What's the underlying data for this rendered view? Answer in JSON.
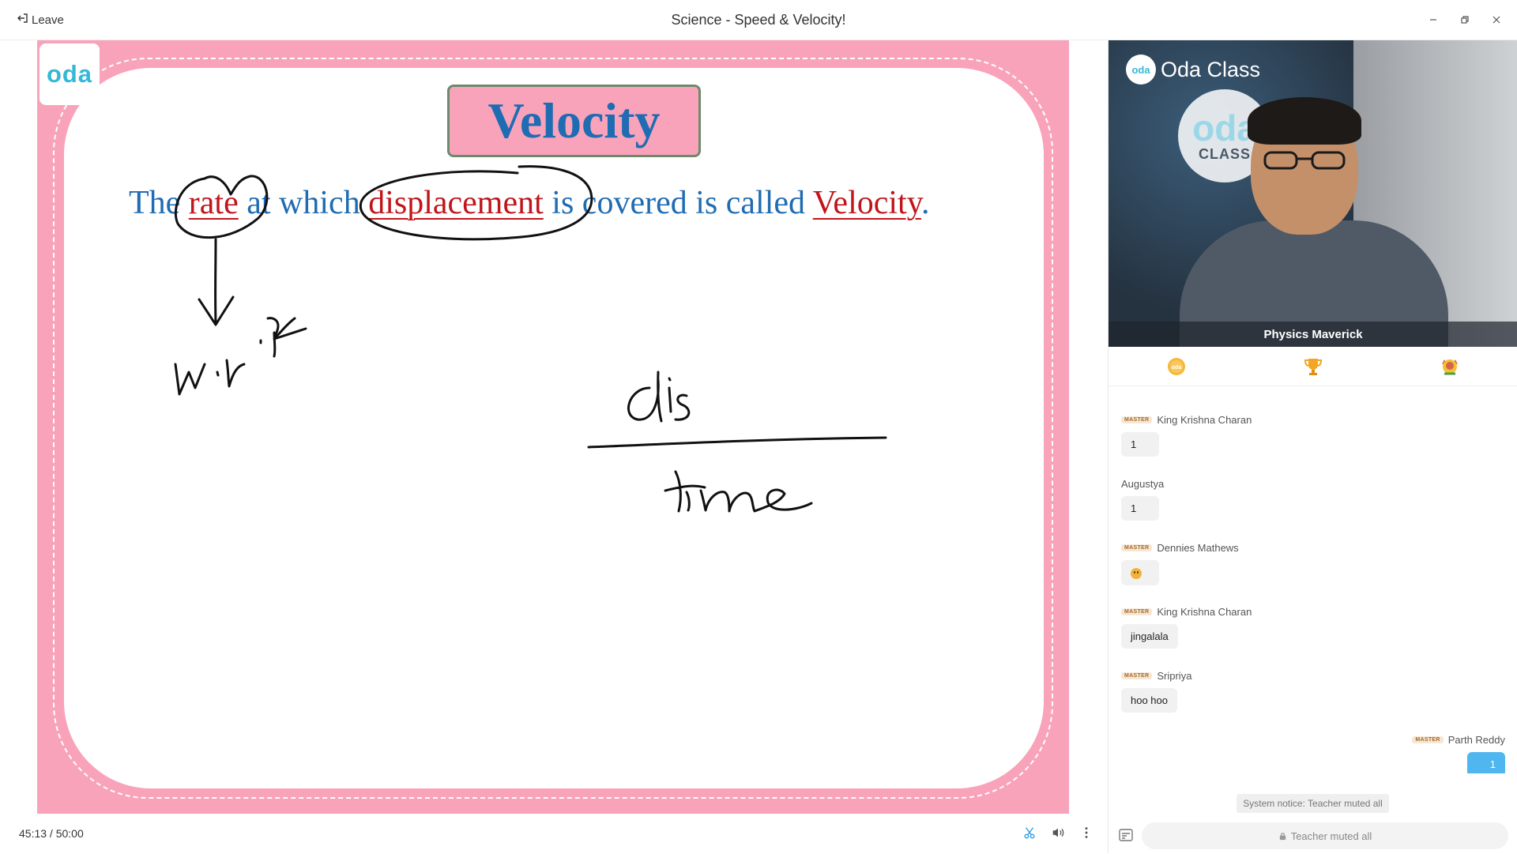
{
  "window": {
    "leave_label": "Leave",
    "title": "Science - Speed & Velocity!",
    "controls": [
      "minimize-icon",
      "restore-icon",
      "close-icon"
    ]
  },
  "slide": {
    "logo_text": "oda",
    "heading": "Velocity",
    "sentence": {
      "w1": "The ",
      "w2": "rate",
      "w3": " at which ",
      "w4": "displacement",
      "w5": " is covered is called ",
      "w6": "Velocity",
      "w7": "."
    },
    "colors": {
      "heading_blue": "#1f6cb3",
      "term_red": "#c0161b",
      "slide_pink": "#f9a3bb"
    }
  },
  "video": {
    "brand": "Oda Class",
    "brand_badge": "oda",
    "wall_logo_top": "oda",
    "wall_logo_bottom": "CLASS",
    "teacher_name": "Physics Maverick"
  },
  "tabs": [
    "chat-coin-icon",
    "trophy-icon",
    "badge-icon"
  ],
  "chat": {
    "master_label": "MASTER",
    "messages": [
      {
        "name": "King Krishna Charan",
        "master": true,
        "text": "1"
      },
      {
        "name": "Augustya",
        "master": false,
        "text": "1"
      },
      {
        "name": "Dennies Mathews",
        "master": true,
        "text": "",
        "emoji": "smile-emoji"
      },
      {
        "name": "King Krishna Charan",
        "master": true,
        "text": "jingalala"
      },
      {
        "name": "Sripriya",
        "master": true,
        "text": "hoo hoo"
      },
      {
        "name": "Parth Reddy",
        "master": true,
        "text": "1",
        "own": true
      }
    ],
    "system_notice": "System notice: Teacher muted all",
    "input_placeholder": "Teacher muted all"
  },
  "bottom": {
    "elapsed": "45:13",
    "separator": " / ",
    "total": "50:00"
  }
}
